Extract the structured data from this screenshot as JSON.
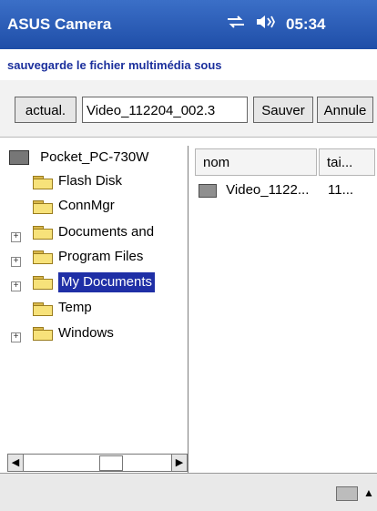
{
  "header": {
    "app_title": "ASUS Camera",
    "time": "05:34",
    "icons": [
      "connectivity-icon",
      "volume-icon"
    ]
  },
  "prompt": {
    "text": "sauvegarde le fichier multimédia sous"
  },
  "toolbar": {
    "actual_label": "actual.",
    "filename_value": "Video_112204_002.3",
    "save_label": "Sauver",
    "cancel_label": "Annule"
  },
  "tree": {
    "root": "Pocket_PC-730W",
    "items": [
      {
        "label": "Flash Disk",
        "expandable": false,
        "selected": false
      },
      {
        "label": "ConnMgr",
        "expandable": false,
        "selected": false
      },
      {
        "label": "Documents and",
        "expandable": true,
        "selected": false
      },
      {
        "label": "Program Files",
        "expandable": true,
        "selected": false
      },
      {
        "label": "My Documents",
        "expandable": true,
        "selected": true
      },
      {
        "label": "Temp",
        "expandable": false,
        "selected": false
      },
      {
        "label": "Windows",
        "expandable": true,
        "selected": false
      }
    ]
  },
  "list": {
    "columns": [
      "nom",
      "tai..."
    ],
    "rows": [
      {
        "name": "Video_1122...",
        "size": "11..."
      }
    ]
  },
  "bottom": {
    "icons": [
      "keyboard-icon",
      "input-menu-icon"
    ]
  },
  "colors": {
    "title_bg": "#2d5fbf",
    "prompt_text": "#1b2f9c",
    "selection": "#1f2fa6"
  }
}
